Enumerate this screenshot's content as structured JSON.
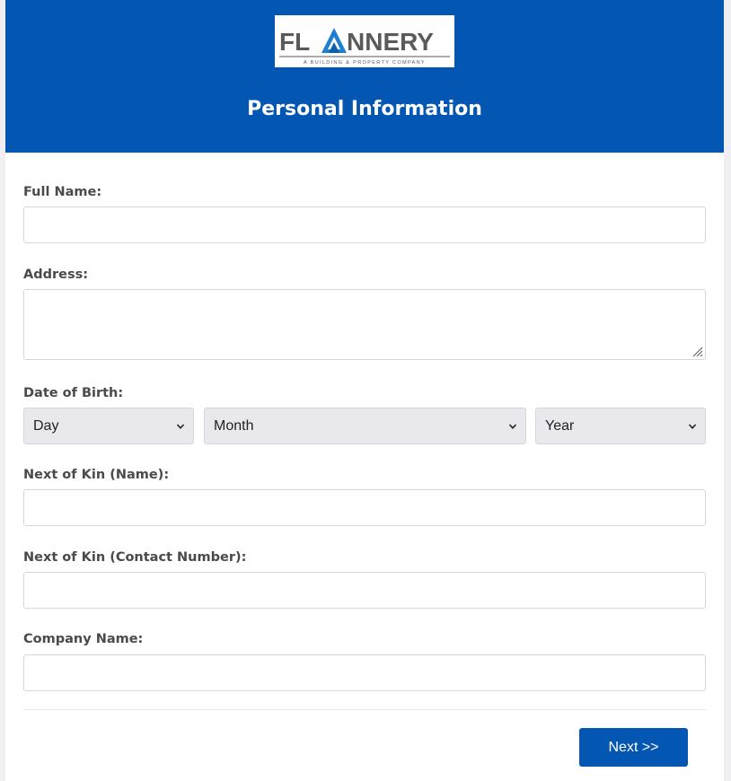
{
  "header": {
    "logo": {
      "wordmark": "FLANNERY",
      "tagline": "A BUILDING & PROPERTY COMPANY"
    },
    "title": "Personal Information"
  },
  "form": {
    "full_name": {
      "label": "Full Name:",
      "value": ""
    },
    "address": {
      "label": "Address:",
      "value": ""
    },
    "date_of_birth": {
      "label": "Date of Birth:",
      "day": "Day",
      "month": "Month",
      "year": "Year"
    },
    "next_of_kin_name": {
      "label": "Next of Kin (Name):",
      "value": ""
    },
    "next_of_kin_contact": {
      "label": "Next of Kin (Contact Number):",
      "value": ""
    },
    "company_name": {
      "label": "Company Name:",
      "value": ""
    }
  },
  "footer": {
    "next_label": "Next >>"
  },
  "colors": {
    "brand_blue": "#0357b3",
    "logo_grey": "#5a5a5a",
    "logo_accent": "#1f7fd0"
  },
  "icons": {
    "logo": "flannery-logo",
    "select_arrow": "chevron-down-icon",
    "textarea_resize": "resize-handle-icon"
  }
}
